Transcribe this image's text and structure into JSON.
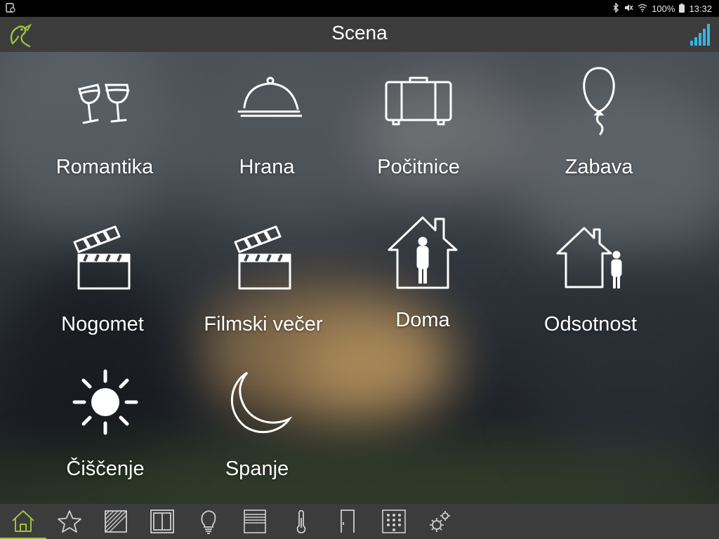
{
  "status_bar": {
    "battery": "100%",
    "time": "13:32"
  },
  "header": {
    "title": "Scena"
  },
  "scenes": [
    {
      "label": "Romantika",
      "icon": "wine-glasses-icon"
    },
    {
      "label": "Hrana",
      "icon": "food-cloche-icon"
    },
    {
      "label": "Počitnice",
      "icon": "suitcase-icon"
    },
    {
      "label": "Zabava",
      "icon": "balloon-icon"
    },
    {
      "label": "Nogomet",
      "icon": "clapperboard-icon"
    },
    {
      "label": "Filmski večer",
      "icon": "clapperboard-icon"
    },
    {
      "label": "Doma",
      "icon": "home-person-icon"
    },
    {
      "label": "Odsotnost",
      "icon": "away-house-icon"
    },
    {
      "label": "Čiščenje",
      "icon": "sun-icon"
    },
    {
      "label": "Spanje",
      "icon": "moon-icon"
    }
  ],
  "bottom_nav": [
    {
      "name": "home",
      "icon": "home-icon",
      "active": true
    },
    {
      "name": "favorites",
      "icon": "star-icon"
    },
    {
      "name": "blinds",
      "icon": "blinds-icon"
    },
    {
      "name": "windows",
      "icon": "window-icon"
    },
    {
      "name": "lights",
      "icon": "bulb-icon"
    },
    {
      "name": "shutters",
      "icon": "shutter-icon"
    },
    {
      "name": "temperature",
      "icon": "thermometer-icon"
    },
    {
      "name": "doors",
      "icon": "door-icon"
    },
    {
      "name": "keypad",
      "icon": "keypad-icon"
    },
    {
      "name": "settings",
      "icon": "gears-icon"
    }
  ],
  "colors": {
    "accent": "#9cc23b",
    "signal": "#35b4e6",
    "bar": "#3c3c3c"
  }
}
